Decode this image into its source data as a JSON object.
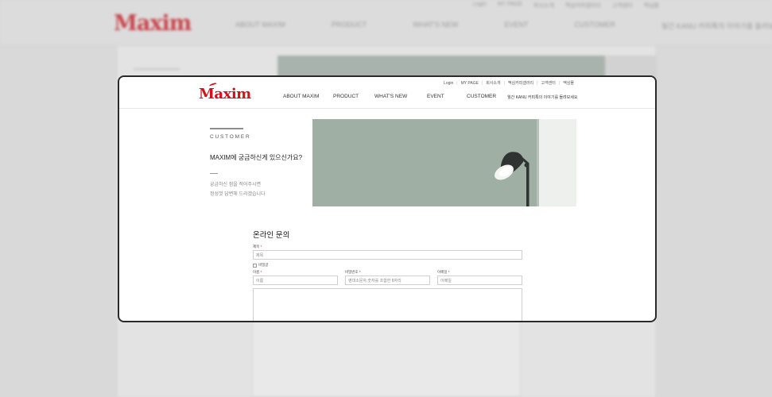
{
  "site": {
    "brand": "Maxim",
    "brand_color": "#d2111c"
  },
  "util_links": [
    "Login",
    "MY PAGE",
    "회사소개",
    "맥심커피갤러리",
    "고객센터",
    "맥심몰"
  ],
  "background_util_links": [
    "Login",
    "MY PAGE",
    "회사소개",
    "맥심커피갤러리",
    "고객센터",
    "맥심몰"
  ],
  "nav": {
    "items": [
      "ABOUT MAXIM",
      "PRODUCT",
      "WHAT'S NEW",
      "EVENT",
      "CUSTOMER"
    ],
    "promo": "월간 KANU 커피톡의 이야기를 들려보세요"
  },
  "customer": {
    "eyebrow": "CUSTOMER",
    "title": "MAXIM에 궁금하신게 있으신가요?",
    "desc_line1": "궁금하신 점을 적어주시면",
    "desc_line2": "정성껏 답변해 드리겠습니다"
  },
  "form": {
    "title": "온라인 문의",
    "subject_label": "제목",
    "subject_placeholder": "제목",
    "secret_label": "비밀글",
    "name_label": "이름",
    "name_placeholder": "이름",
    "password_label": "비밀번호",
    "password_placeholder": "영대소문자,숫자를 조합한 8자리",
    "email_label": "이메일",
    "email_placeholder": "이메일",
    "required_mark": "*"
  },
  "colors": {
    "banner_wall": "#9fafa4",
    "lamp": "#2f3331"
  }
}
